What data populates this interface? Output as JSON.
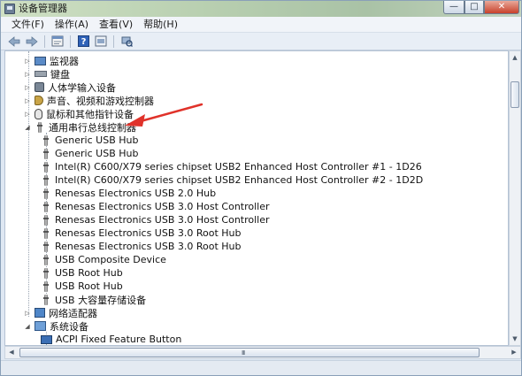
{
  "window": {
    "title": "设备管理器",
    "buttons": {
      "minimize": "—",
      "maximize": "□",
      "close": "✕"
    }
  },
  "menu": {
    "items": [
      "文件(F)",
      "操作(A)",
      "查看(V)",
      "帮助(H)"
    ]
  },
  "toolbar": {
    "icons": [
      "back-arrow-icon",
      "forward-arrow-icon",
      "properties-icon",
      "help-icon",
      "show-hidden-icon",
      "scan-hardware-icon"
    ]
  },
  "tree": {
    "categories": {
      "monitors": "监视器",
      "keyboards": "键盘",
      "hid": "人体学输入设备",
      "sound": "声音、视频和游戏控制器",
      "mice": "鼠标和其他指针设备",
      "usb": "通用串行总线控制器",
      "network": "网络适配器",
      "system": "系统设备"
    },
    "usb_children": [
      "Generic USB Hub",
      "Generic USB Hub",
      "Intel(R) C600/X79 series chipset USB2 Enhanced Host Controller #1 - 1D26",
      "Intel(R) C600/X79 series chipset USB2 Enhanced Host Controller #2 - 1D2D",
      "Renesas Electronics USB 2.0 Hub",
      "Renesas Electronics USB 3.0 Host Controller",
      "Renesas Electronics USB 3.0 Host Controller",
      "Renesas Electronics USB 3.0 Root Hub",
      "Renesas Electronics USB 3.0 Root Hub",
      "USB Composite Device",
      "USB Root Hub",
      "USB Root Hub",
      "USB 大容量存储设备"
    ],
    "system_children": [
      "ACPI Fixed Feature Button"
    ]
  },
  "scrollbar": {
    "grip": "III"
  },
  "colors": {
    "annotation_arrow": "#e0322a"
  }
}
